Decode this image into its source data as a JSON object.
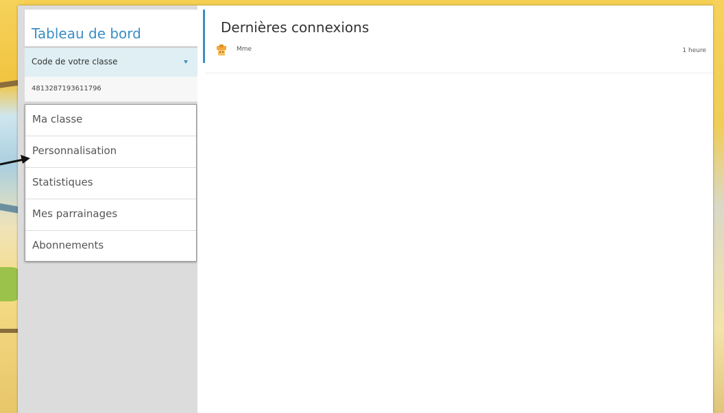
{
  "sidebar": {
    "title": "Tableau de bord",
    "class_select": {
      "label": "Code de votre classe"
    },
    "class_code": "4813287193611796",
    "items": [
      {
        "label": "Ma classe"
      },
      {
        "label": "Personnalisation"
      },
      {
        "label": "Statistiques"
      },
      {
        "label": "Mes parrainages"
      },
      {
        "label": "Abonnements"
      }
    ]
  },
  "main": {
    "title": "Dernières connexions",
    "connections": [
      {
        "name": "Mme",
        "time": "1 heure",
        "icon": "user-avatar-icon"
      }
    ]
  },
  "colors": {
    "accent": "#3b8dc4",
    "select_bg": "#dfeff4",
    "sidebar_bg": "#dcdcdc",
    "avatar": "#f2a93b"
  }
}
